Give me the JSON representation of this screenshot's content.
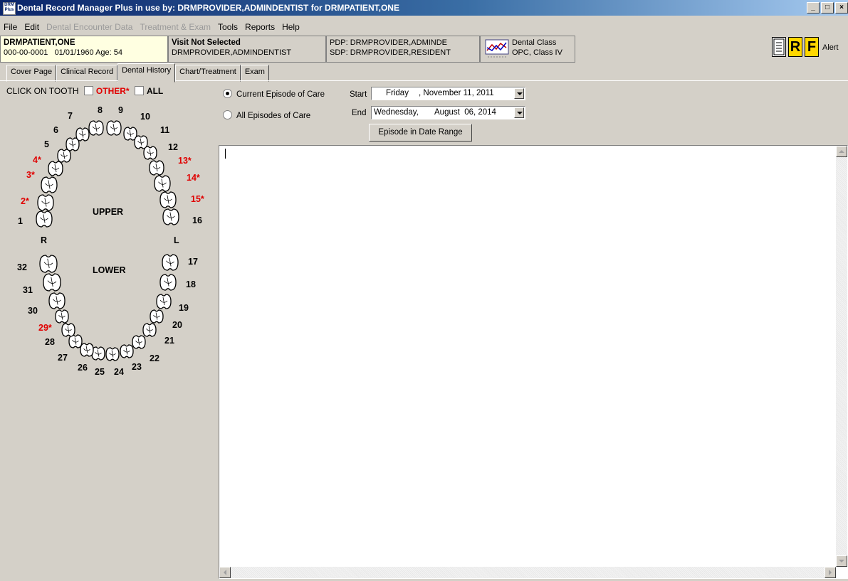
{
  "window": {
    "title": "Dental Record Manager Plus in use by: DRMPROVIDER,ADMINDENTIST for DRMPATIENT,ONE",
    "icon_text": "DRM Plus"
  },
  "menu": [
    {
      "label": "File",
      "disabled": false
    },
    {
      "label": "Edit",
      "disabled": false
    },
    {
      "label": "Dental Encounter Data",
      "disabled": true
    },
    {
      "label": "Treatment & Exam",
      "disabled": true
    },
    {
      "label": "Tools",
      "disabled": false
    },
    {
      "label": "Reports",
      "disabled": false
    },
    {
      "label": "Help",
      "disabled": false
    }
  ],
  "patient": {
    "name": "DRMPATIENT,ONE",
    "id": "000-00-0001",
    "dob": "01/01/1960",
    "age_label": "Age:",
    "age": "54"
  },
  "visit": {
    "title": "Visit Not Selected",
    "provider": "DRMPROVIDER,ADMINDENTIST"
  },
  "providers": {
    "pdp": "PDP: DRMPROVIDER,ADMINDE",
    "sdp": "SDP: DRMPROVIDER,RESIDENT"
  },
  "dental_class": {
    "line1": "Dental Class",
    "line2": "OPC, Class IV"
  },
  "toolbar": {
    "notes_icon": "notes-icon",
    "r_label": "R",
    "f_label": "F",
    "alert_label": "Alert"
  },
  "tabs": [
    {
      "label": "Cover Page",
      "active": false
    },
    {
      "label": "Clinical Record",
      "active": false
    },
    {
      "label": "Dental History",
      "active": true
    },
    {
      "label": "Chart/Treatment",
      "active": false
    },
    {
      "label": "Exam",
      "active": false
    }
  ],
  "tooth_panel": {
    "click_label": "CLICK ON TOOTH",
    "other_label": "OTHER*",
    "all_label": "ALL",
    "upper_label": "UPPER",
    "lower_label": "LOWER",
    "right_label": "R",
    "left_label": "L",
    "teeth": [
      {
        "n": "1",
        "red": false
      },
      {
        "n": "2*",
        "red": true
      },
      {
        "n": "3*",
        "red": true
      },
      {
        "n": "4*",
        "red": true
      },
      {
        "n": "5",
        "red": false
      },
      {
        "n": "6",
        "red": false
      },
      {
        "n": "7",
        "red": false
      },
      {
        "n": "8",
        "red": false
      },
      {
        "n": "9",
        "red": false
      },
      {
        "n": "10",
        "red": false
      },
      {
        "n": "11",
        "red": false
      },
      {
        "n": "12",
        "red": false
      },
      {
        "n": "13*",
        "red": true
      },
      {
        "n": "14*",
        "red": true
      },
      {
        "n": "15*",
        "red": true
      },
      {
        "n": "16",
        "red": false
      },
      {
        "n": "17",
        "red": false
      },
      {
        "n": "18",
        "red": false
      },
      {
        "n": "19",
        "red": false
      },
      {
        "n": "20",
        "red": false
      },
      {
        "n": "21",
        "red": false
      },
      {
        "n": "22",
        "red": false
      },
      {
        "n": "23",
        "red": false
      },
      {
        "n": "24",
        "red": false
      },
      {
        "n": "25",
        "red": false
      },
      {
        "n": "26",
        "red": false
      },
      {
        "n": "27",
        "red": false
      },
      {
        "n": "28",
        "red": false
      },
      {
        "n": "29*",
        "red": true
      },
      {
        "n": "30",
        "red": false
      },
      {
        "n": "31",
        "red": false
      },
      {
        "n": "32",
        "red": false
      }
    ]
  },
  "episode": {
    "current_label": "Current Episode of Care",
    "all_label": "All Episodes of Care",
    "selected": "current",
    "start_label": "Start",
    "start_day": "Friday",
    "start_date": ", November 11, 2011",
    "end_label": "End",
    "end_day": "Wednesday,",
    "end_date": "August  06, 2014",
    "range_button": "Episode in Date Range"
  },
  "history_text": ""
}
